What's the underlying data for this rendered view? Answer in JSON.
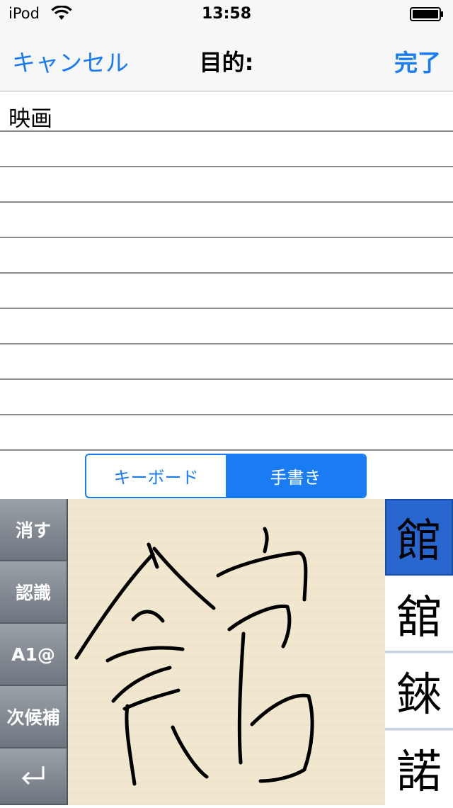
{
  "status_bar": {
    "carrier": "iPod",
    "time": "13:58"
  },
  "nav": {
    "cancel_label": "キャンセル",
    "title": "目的:",
    "done_label": "完了"
  },
  "text_area": {
    "content": "映画"
  },
  "input_mode": {
    "keyboard_label": "キーボード",
    "handwriting_label": "手書き",
    "selected": "手書き"
  },
  "tools": {
    "erase_label": "消す",
    "recognize_label": "認識",
    "alnum_label": "A1@",
    "next_candidate_label": "次候補",
    "return_icon": "return-arrow-icon"
  },
  "candidates": [
    "館",
    "舘",
    "錸",
    "諾"
  ],
  "colors": {
    "accent": "#1a7cf3",
    "selected_candidate": "#2767cf",
    "canvas": "#f1e7cf"
  }
}
